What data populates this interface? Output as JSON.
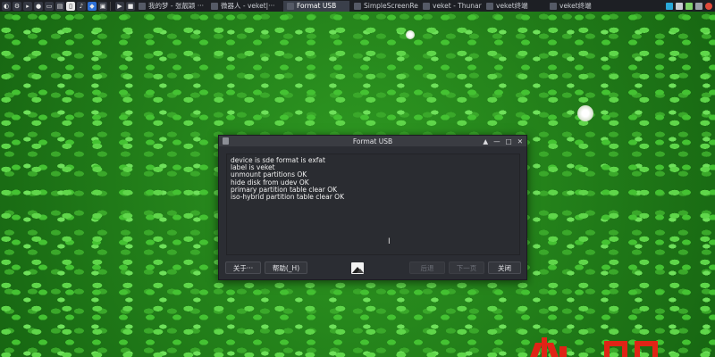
{
  "taskbar": {
    "tasks": [
      {
        "label": "我的梦 - 张靓颖 ···"
      },
      {
        "label": "微器人 - veket|···"
      },
      {
        "label": "Format USB"
      },
      {
        "label": "SimpleScreenRe···"
      },
      {
        "label": "veket - Thunar"
      },
      {
        "label": "veket终端"
      },
      {
        "label": "veket终端"
      }
    ],
    "active_task": "Format USB"
  },
  "window": {
    "title": "Format USB",
    "controls": {
      "shade": "▲",
      "minimize": "—",
      "maximize": "□",
      "close": "✕"
    },
    "log_lines": [
      "device is sde format is exfat",
      "label is veket",
      "unmount partitions OK",
      "hide disk from udev OK",
      "primary partition table clear OK",
      "iso-hybrid partition table clear OK"
    ],
    "buttons": {
      "about": "关于···",
      "help": "帮助(_H)",
      "back": "后退",
      "next": "下一页",
      "close": "关闭"
    }
  },
  "colors": {
    "wallpaper": "#2f9a22",
    "taskbar": "#1d1f24",
    "window_bg": "#2b2d33",
    "logo_red": "#e02416"
  }
}
